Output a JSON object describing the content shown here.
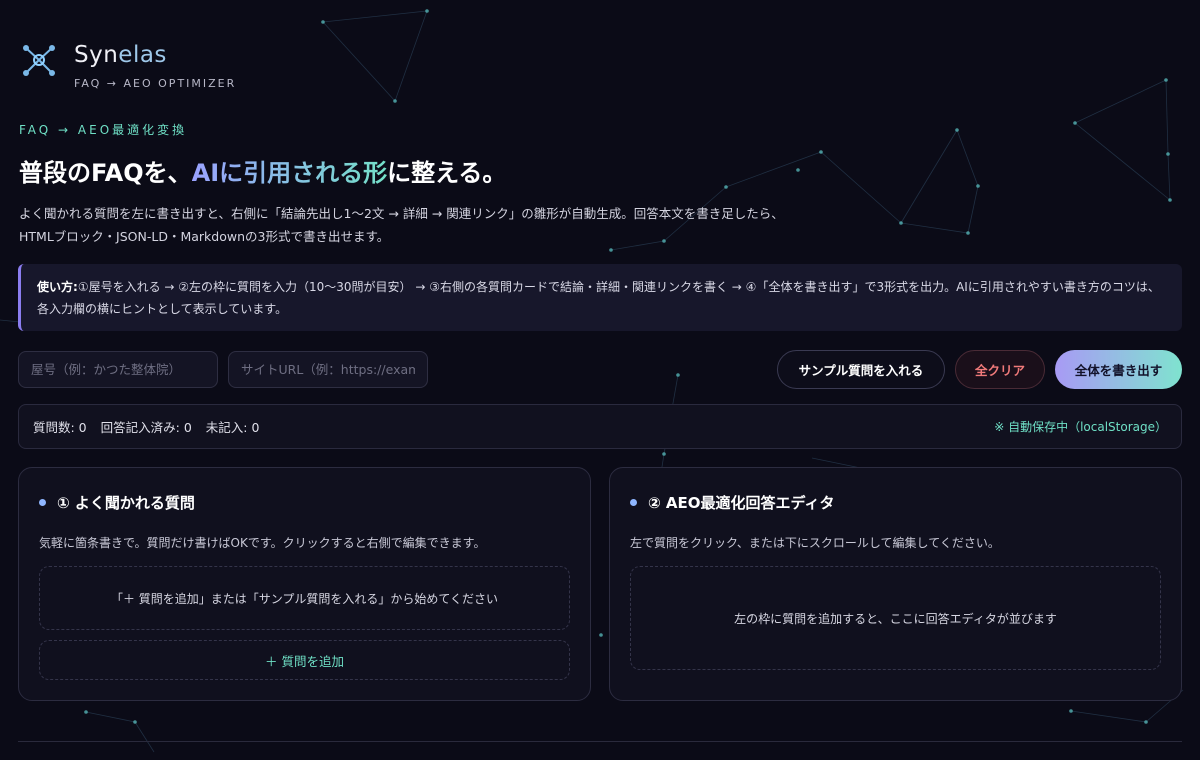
{
  "brand": {
    "name_main": "Syn",
    "name_accent": "elas",
    "subtitle": "FAQ → AEO OPTIMIZER",
    "logo_icon": "network-hub-icon"
  },
  "hero": {
    "eyebrow": "FAQ → AEO最適化変換",
    "headline_pre": "普段のFAQを、",
    "headline_highlight": "AIに引用される形",
    "headline_post": "に整える。",
    "lead": "よく聞かれる質問を左に書き出すと、右側に「結論先出し1〜2文 → 詳細 → 関連リンク」の雛形が自動生成。回答本文を書き足したら、HTMLブロック・JSON-LD・Markdownの3形式で書き出せます。"
  },
  "howto": {
    "label": "使い方:",
    "text": "①屋号を入れる → ②左の枠に質問を入力（10〜30問が目安） → ③右側の各質問カードで結論・詳細・関連リンクを書く → ④「全体を書き出す」で3形式を出力。AIに引用されやすい書き方のコツは、各入力欄の横にヒントとして表示しています。"
  },
  "toolbar": {
    "shop_placeholder": "屋号（例：かつた整体院）",
    "url_placeholder": "サイトURL（例：https://example.com）",
    "sample_label": "サンプル質問を入れる",
    "clear_label": "全クリア",
    "export_label": "全体を書き出す"
  },
  "stats": {
    "questions": "質問数: 0",
    "answered": "回答記入済み: 0",
    "unanswered": "未記入: 0",
    "autosave": "※ 自動保存中（localStorage）"
  },
  "left_panel": {
    "title": "① よく聞かれる質問",
    "desc": "気軽に箇条書きで。質問だけ書けばOKです。クリックすると右側で編集できます。",
    "empty": "「＋ 質問を追加」または「サンプル質問を入れる」から始めてください",
    "add_label": "＋ 質問を追加"
  },
  "right_panel": {
    "title": "② AEO最適化回答エディタ",
    "desc": "左で質問をクリック、または下にスクロールして編集してください。",
    "empty": "左の枠に質問を追加すると、ここに回答エディタが並びます"
  },
  "colors": {
    "background": "#0b0b17",
    "accent_teal": "#6fe0c6",
    "accent_purple": "#8b7df0",
    "danger": "#f07a7a"
  }
}
